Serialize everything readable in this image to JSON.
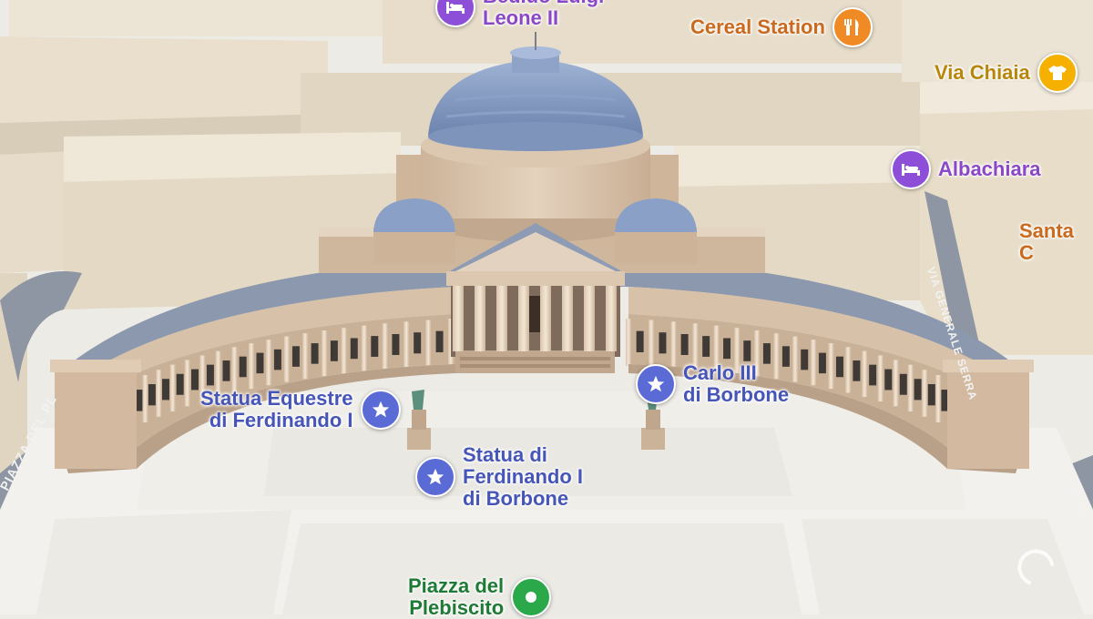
{
  "colors": {
    "hotel": "#8e4fd8",
    "restaurant": "#f08a24",
    "shop": "#f5b000",
    "landmark": "#5a6bd6",
    "park": "#2aa84a",
    "hotel_text": "#8a47c7",
    "restaurant_text": "#c96a1e",
    "shop_text": "#b8860b",
    "landmark_text": "#4655b8",
    "park_text": "#1f7a35"
  },
  "pois": {
    "bed_leone": {
      "label": "Bed.uo Luigi\nLeone II",
      "icon": "bed-icon",
      "category": "hotel"
    },
    "cereal_station": {
      "label": "Cereal Station",
      "icon": "fork-knife-icon",
      "category": "restaurant"
    },
    "via_chiaia": {
      "label": "Via Chiaia",
      "icon": "shirt-icon",
      "category": "shop"
    },
    "albachiara": {
      "label": "Albachiara",
      "icon": "bed-icon",
      "category": "hotel"
    },
    "santa": {
      "label": "Santa C"
    },
    "carlo": {
      "label": "Carlo III\ndi Borbone",
      "icon": "star-icon",
      "category": "landmark"
    },
    "statua_equestre": {
      "label": "Statua Equestre\ndi Ferdinando I",
      "icon": "star-icon",
      "category": "landmark"
    },
    "statua_ferdinando": {
      "label": "Statua di\nFerdinando I\ndi Borbone",
      "icon": "star-icon",
      "category": "landmark"
    },
    "piazza_plebiscito": {
      "label": "Piazza del\nPlebiscito",
      "icon": "pin-dot-icon",
      "category": "park"
    }
  },
  "streets": {
    "via_gen": "VIA GENERALE SERRA",
    "piazza_dei": "PIAZZA DEL PL",
    "piazza_right": "PIAZ"
  }
}
